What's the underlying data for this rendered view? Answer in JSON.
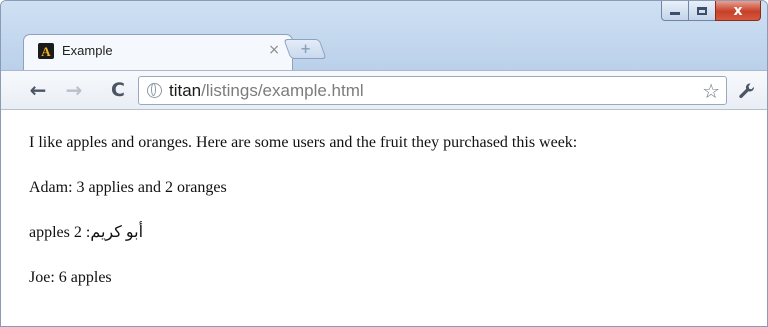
{
  "browser": {
    "tab": {
      "favicon_letter": "A",
      "title": "Example",
      "close_glyph": "×"
    },
    "new_tab_glyph": "+",
    "toolbar": {
      "back_glyph": "←",
      "forward_glyph": "→",
      "reload_glyph": "C",
      "url_host": "titan",
      "url_path": "/listings/example.html",
      "bookmark_glyph": "☆"
    },
    "window_controls": {
      "close_glyph": "x"
    }
  },
  "page": {
    "intro": "I like apples and oranges. Here are some users and the fruit they purchased this week:",
    "lines": [
      "Adam: 3 applies and 2 oranges",
      "أبو كريم: 2 apples",
      "Joe: 6 apples"
    ]
  },
  "colors": {
    "frame": "#bad0ea",
    "close_button": "#c7402a",
    "favicon_bg": "#1b1b1b",
    "favicon_letter": "#f2b51d",
    "url_path": "#7c7c7c"
  }
}
